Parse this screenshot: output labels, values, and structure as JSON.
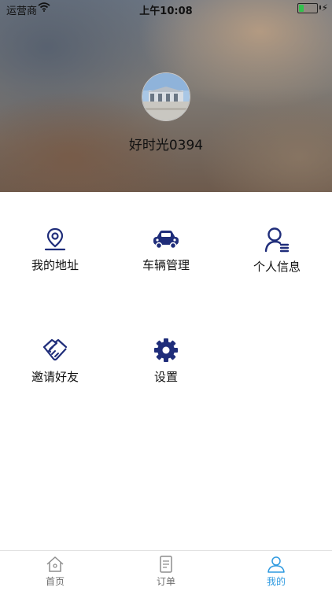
{
  "status_bar": {
    "carrier": "运营商",
    "time": "上午10:08"
  },
  "profile": {
    "nickname": "好时光0394"
  },
  "menu": [
    {
      "label": "我的地址",
      "icon": "location-pin-icon"
    },
    {
      "label": "车辆管理",
      "icon": "car-icon"
    },
    {
      "label": "个人信息",
      "icon": "user-info-icon"
    },
    {
      "label": "邀请好友",
      "icon": "handshake-icon"
    },
    {
      "label": "设置",
      "icon": "gear-icon"
    }
  ],
  "tabbar": [
    {
      "label": "首页",
      "icon": "home-icon"
    },
    {
      "label": "订单",
      "icon": "document-icon"
    },
    {
      "label": "我的",
      "icon": "person-icon"
    }
  ],
  "colors": {
    "icon_navy": "#1f2d7a",
    "tab_active": "#2f9ae0",
    "tab_inactive": "#8e8e8e"
  }
}
